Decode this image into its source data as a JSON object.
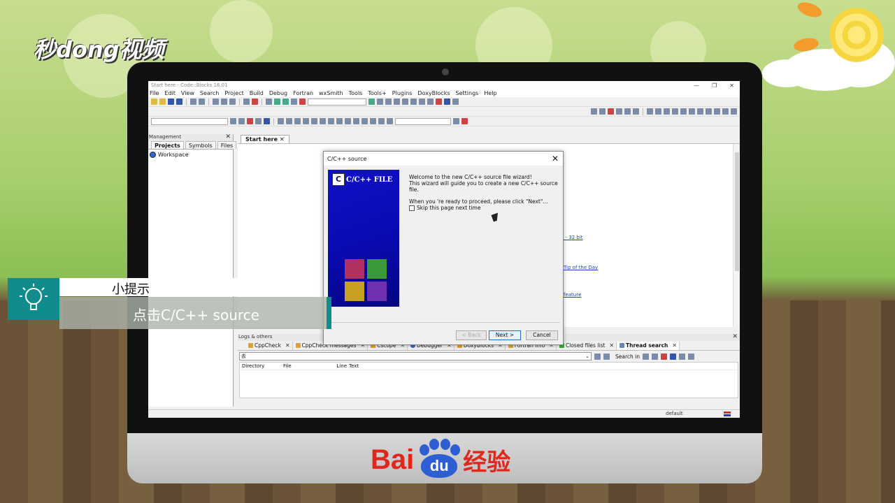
{
  "brand": {
    "top_logo": "秒dong视频",
    "bottom_logo_bai": "Bai",
    "bottom_logo_du": "du",
    "bottom_logo_jingyan": "经验"
  },
  "ide": {
    "title": "Start here - Code::Blocks 16.01",
    "menu": [
      "File",
      "Edit",
      "View",
      "Search",
      "Project",
      "Build",
      "Debug",
      "Fortran",
      "wxSmith",
      "Tools",
      "Tools+",
      "Plugins",
      "DoxyBlocks",
      "Settings",
      "Help"
    ],
    "management": {
      "title": "Management",
      "tabs": [
        "Projects",
        "Symbols",
        "Files"
      ],
      "workspace": "Workspace"
    },
    "editor_tab": "Start here",
    "start_page_links": [
      "e - 32 bit",
      "Tip of the Day",
      "feature"
    ],
    "logs": {
      "title": "Logs & others",
      "tabs": [
        "CppCheck",
        "CppCheck messages",
        "Cscope",
        "Debugger",
        "DoxyBlocks",
        "Fortran info",
        "Closed files list",
        "Thread search"
      ],
      "search_value": "去",
      "search_in_label": "Search in",
      "columns": [
        "Directory",
        "File",
        "Line",
        "Text"
      ]
    },
    "status": {
      "mode": "default"
    }
  },
  "dialog": {
    "title": "C/C++ source",
    "banner_label": "C/C++ FILE",
    "banner_icon_letter": "C",
    "line1": "Welcome to the new C/C++ source file wizard!",
    "line2": "This wizard will guide you to create a new C/C++ source file.",
    "line3": "When you 're ready to proceed, please click \"Next\"...",
    "skip_label": "Skip this page next time",
    "back_label": "< Back",
    "next_label": "Next >",
    "cancel_label": "Cancel"
  },
  "tip": {
    "heading": "小提示",
    "text": "点击C/C++ source"
  }
}
